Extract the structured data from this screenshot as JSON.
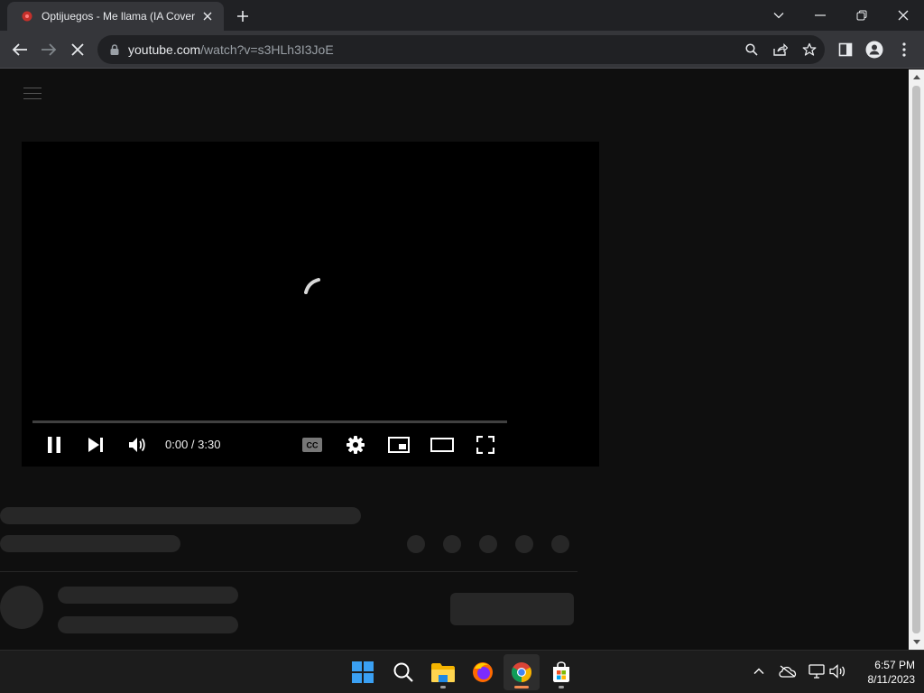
{
  "browser": {
    "tab": {
      "title": "Optijuegos - Me llama (IA Cover)",
      "favicon": "youtube-icon",
      "close_icon": "close-icon"
    },
    "new_tab_icon": "plus-icon",
    "window_controls": [
      "chevron-down-icon",
      "minimize-icon",
      "restore-icon",
      "close-icon"
    ],
    "toolbar": {
      "back_icon": "arrow-left-icon",
      "forward_icon": "arrow-right-icon",
      "stop_icon": "close-icon",
      "url_host": "youtube.com",
      "url_path": "/watch?v=s3HLh3I3JoE",
      "omnibox_icons": [
        "search-icon",
        "share-icon",
        "star-icon"
      ],
      "right_icons": [
        "side-panel-icon",
        "profile-icon",
        "kebab-menu-icon"
      ]
    }
  },
  "player": {
    "time_display": "0:00 / 3:30",
    "progress_fraction": 0.0,
    "controls_left": [
      "pause-icon",
      "next-icon",
      "volume-icon"
    ],
    "controls_right": [
      "captions-icon",
      "settings-icon",
      "miniplayer-icon",
      "theater-icon",
      "fullscreen-icon"
    ]
  },
  "taskbar": {
    "apps": [
      "windows-start-icon",
      "search-icon",
      "file-explorer-icon",
      "firefox-icon",
      "chrome-icon",
      "microsoft-store-icon"
    ],
    "tray_icons": [
      "chevron-up-icon",
      "onedrive-offline-icon",
      "network-icon",
      "speaker-icon"
    ],
    "clock_time": "6:57 PM",
    "clock_date": "8/11/2023"
  },
  "colors": {
    "page_bg": "#0f0f0f",
    "skeleton": "#272727",
    "chrome_tab_indicator": "#f28b50"
  }
}
